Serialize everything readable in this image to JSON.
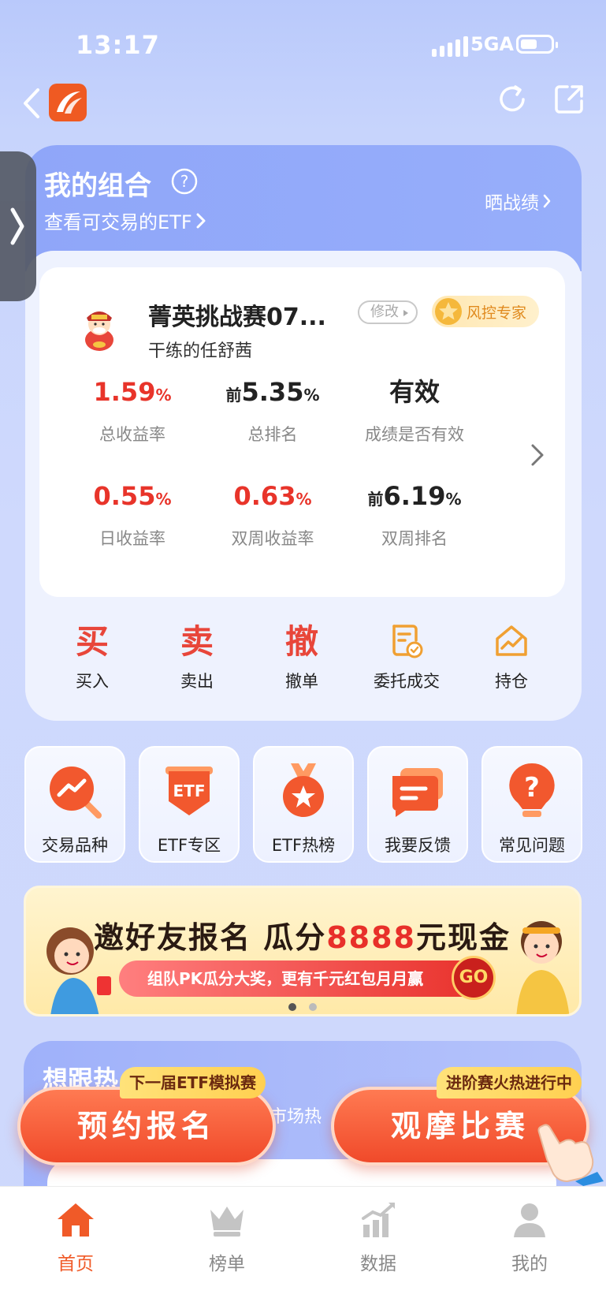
{
  "status_bar": {
    "time": "13:17",
    "network": "5GA"
  },
  "portfolio": {
    "title": "我的组合",
    "etf_link": "查看可交易的ETF",
    "show_link": "晒战绩",
    "contest_name": "菁英挑战赛07...",
    "edit_label": "修改",
    "badge_label": "风控专家",
    "user_name": "干练的任舒茜",
    "stats": [
      {
        "prefix": "",
        "value": "1.59",
        "unit": "%",
        "label": "总收益率",
        "color": "red"
      },
      {
        "prefix": "前",
        "value": "5.35",
        "unit": "%",
        "label": "总排名",
        "color": "black"
      },
      {
        "prefix": "",
        "value": "有效",
        "unit": "",
        "label": "成绩是否有效",
        "color": "black"
      },
      {
        "prefix": "",
        "value": "0.55",
        "unit": "%",
        "label": "日收益率",
        "color": "red"
      },
      {
        "prefix": "",
        "value": "0.63",
        "unit": "%",
        "label": "双周收益率",
        "color": "red"
      },
      {
        "prefix": "前",
        "value": "6.19",
        "unit": "%",
        "label": "双周排名",
        "color": "black"
      }
    ],
    "actions": [
      {
        "glyph": "买",
        "label": "买入"
      },
      {
        "glyph": "卖",
        "label": "卖出"
      },
      {
        "glyph": "撤",
        "label": "撤单"
      },
      {
        "glyph": "",
        "label": "委托成交"
      },
      {
        "glyph": "",
        "label": "持仓"
      }
    ]
  },
  "shortcuts": [
    {
      "label": "交易品种",
      "icon": "trend-magnifier-icon"
    },
    {
      "label": "ETF专区",
      "icon": "etf-shield-icon",
      "icon_text": "ETF"
    },
    {
      "label": "ETF热榜",
      "icon": "medal-star-icon"
    },
    {
      "label": "我要反馈",
      "icon": "chat-bubble-icon"
    },
    {
      "label": "常见问题",
      "icon": "question-bulb-icon",
      "icon_text": "?"
    }
  ],
  "banner": {
    "title_a": "邀好友报名 瓜分",
    "title_amount": "8888",
    "title_b": "元现金",
    "subtitle": "组队PK瓜分大奖，更有千元红包月月赢",
    "go": "GO"
  },
  "follow": {
    "title": "想跟热",
    "subtitle": "市场热"
  },
  "cta": {
    "left_tag": "下一届ETF模拟赛",
    "left_label": "预约报名",
    "right_tag": "进阶赛火热进行中",
    "right_label": "观摩比赛"
  },
  "tabbar": [
    {
      "label": "首页",
      "icon": "home-icon",
      "active": true
    },
    {
      "label": "榜单",
      "icon": "crown-icon",
      "active": false
    },
    {
      "label": "数据",
      "icon": "bar-chart-icon",
      "active": false
    },
    {
      "label": "我的",
      "icon": "user-icon",
      "active": false
    }
  ],
  "colors": {
    "accent": "#f05a28",
    "red": "#e8342a",
    "primary_bg": "#c7d4fc"
  }
}
